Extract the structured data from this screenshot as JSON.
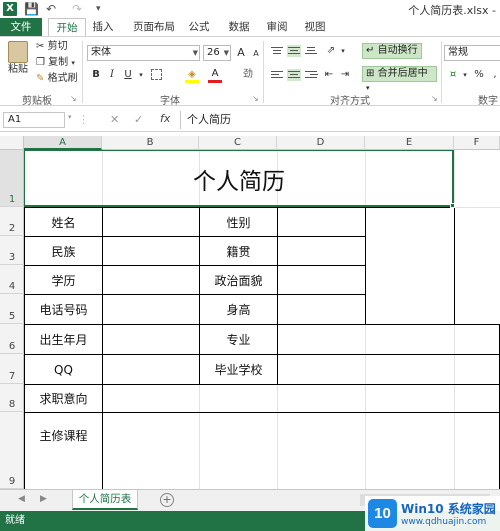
{
  "colors": {
    "excel_green": "#217346",
    "ribbon_accent": "#cde6c7",
    "watermark_blue": "#1e88e5"
  },
  "titlebar": {
    "app_icon": "X",
    "document_title": "个人简历表.xlsx -"
  },
  "ribbon_tabs": [
    "文件",
    "开始",
    "插入",
    "页面布局",
    "公式",
    "数据",
    "审阅",
    "视图"
  ],
  "clipboard": {
    "paste": "粘贴",
    "cut": "剪切",
    "copy": "复制",
    "format_painter": "格式刷",
    "group": "剪贴板"
  },
  "font": {
    "name": "宋体",
    "size": "26",
    "bold": "B",
    "italic": "I",
    "underline": "U",
    "grow": "A",
    "shrink": "A",
    "font_color": "A",
    "group": "字体"
  },
  "alignment": {
    "wrap_text": "自动换行",
    "merge_center": "合并后居中",
    "group": "对齐方式"
  },
  "number": {
    "format": "常规",
    "percent": "%",
    "group": "数字"
  },
  "formula_bar": {
    "name_box": "A1",
    "cancel": "✕",
    "enter": "✓",
    "fx": "fx",
    "content": "个人简历"
  },
  "columns": [
    "A",
    "B",
    "C",
    "D",
    "E",
    "F"
  ],
  "rows": [
    "1",
    "2",
    "3",
    "4",
    "5",
    "6",
    "7",
    "8",
    "9"
  ],
  "resume": {
    "title": "个人简历",
    "name": "姓名",
    "gender": "性别",
    "ethnicity": "民族",
    "native_place": "籍贯",
    "education": "学历",
    "political_status": "政治面貌",
    "phone": "电话号码",
    "height": "身高",
    "birth_date": "出生年月",
    "major": "专业",
    "qq": "QQ",
    "school": "毕业学校",
    "job_intention": "求职意向",
    "courses": "主修课程"
  },
  "sheet_tabs": {
    "active": "个人简历表",
    "add": "+"
  },
  "status": {
    "ready": "就绪"
  },
  "watermark": {
    "logo": "10",
    "title": "Win10 系统家园",
    "url": "www.qdhuajin.com"
  }
}
